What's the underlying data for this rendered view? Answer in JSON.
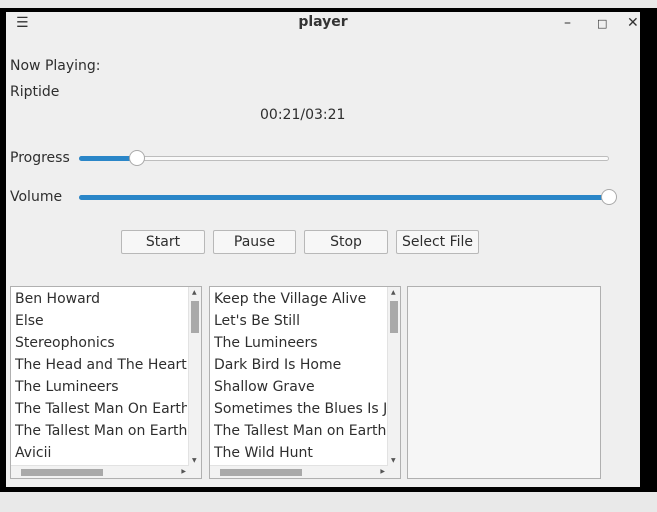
{
  "window": {
    "title": "player",
    "menu_icon": "hamburger-menu-icon",
    "minimize_icon": "minimize-icon",
    "maximize_icon": "maximize-icon",
    "close_icon": "close-icon"
  },
  "now_playing": {
    "label": "Now Playing:",
    "track": "Riptide",
    "time": "00:21/03:21"
  },
  "progress": {
    "label": "Progress",
    "value_percent": 11
  },
  "volume": {
    "label": "Volume",
    "value_percent": 100
  },
  "buttons": {
    "start": "Start",
    "pause": "Pause",
    "stop": "Stop",
    "select_file": "Select File"
  },
  "artists": [
    "Ben Howard",
    "Else",
    "Stereophonics",
    "The Head and The Heart",
    "The Lumineers",
    "The Tallest Man On Earth",
    "The Tallest Man on Earth",
    "Avicii"
  ],
  "albums": [
    "Keep the Village Alive",
    "Let's Be Still",
    "The Lumineers",
    "Dark Bird Is Home",
    "Shallow Grave",
    "Sometimes the Blues Is Just a Passing Bird",
    "The Tallest Man on Earth (EP)",
    "The Wild Hunt"
  ],
  "colors": {
    "accent": "#2a86c8",
    "background": "#efefef",
    "frame": "#000000"
  }
}
